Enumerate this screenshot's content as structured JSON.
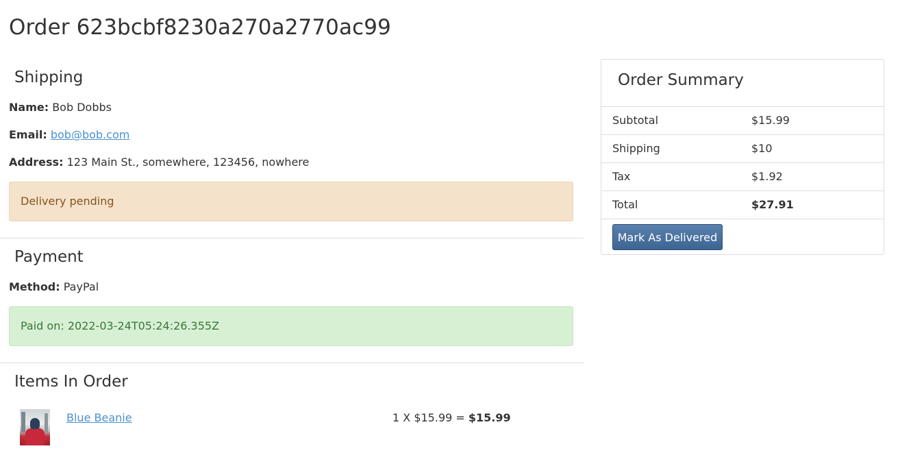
{
  "page": {
    "title_prefix": "Order",
    "order_id": "623bcbf8230a270a2770ac99"
  },
  "shipping": {
    "heading": "Shipping",
    "name_label": "Name:",
    "name_value": "Bob Dobbs",
    "email_label": "Email:",
    "email_value": "bob@bob.com",
    "address_label": "Address:",
    "address_value": "123 Main St., somewhere, 123456, nowhere",
    "status_text": "Delivery pending"
  },
  "payment": {
    "heading": "Payment",
    "method_label": "Method:",
    "method_value": "PayPal",
    "status_text": "Paid on: 2022-03-24T05:24:26.355Z"
  },
  "items": {
    "heading": "Items In Order",
    "list": [
      {
        "name": "Blue Beanie",
        "qty_price": "1 X $15.99 =",
        "total": "$15.99"
      }
    ]
  },
  "summary": {
    "heading": "Order Summary",
    "rows": [
      {
        "label": "Subtotal",
        "value": "$15.99"
      },
      {
        "label": "Shipping",
        "value": "$10"
      },
      {
        "label": "Tax",
        "value": "$1.92"
      },
      {
        "label": "Total",
        "value": "$27.91"
      }
    ],
    "deliver_button": "Mark As Delivered"
  },
  "colors": {
    "link": "#4a90d0",
    "warning_bg": "#f5e2cb",
    "warning_text": "#86541e",
    "success_bg": "#d7f0d4",
    "success_text": "#3b763a",
    "button_bg": "#4a6f9c"
  }
}
